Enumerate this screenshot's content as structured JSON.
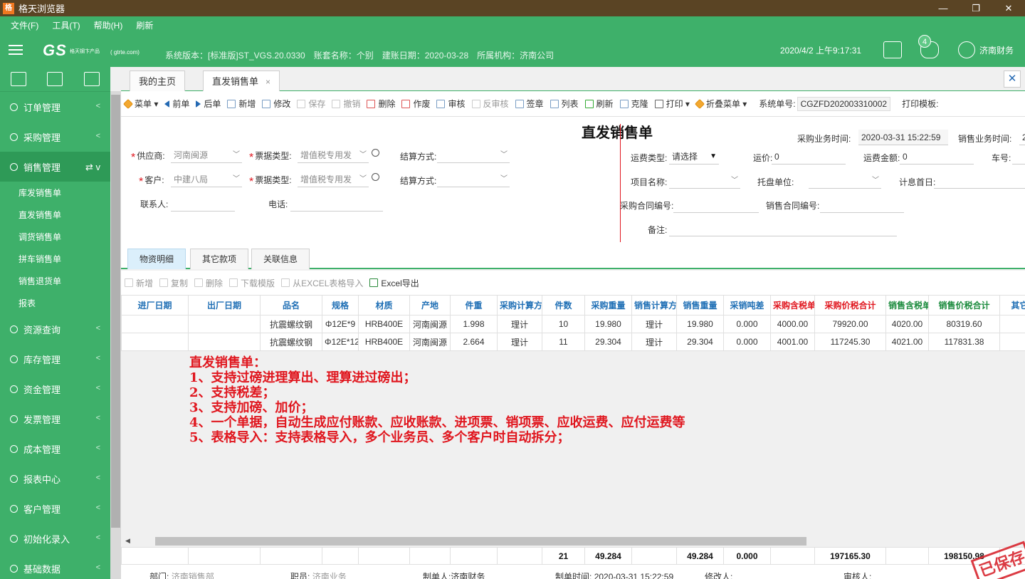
{
  "window": {
    "title": "格天浏览器",
    "min": "—",
    "max": "❐",
    "close": "✕"
  },
  "menu": [
    "文件(F)",
    "工具(T)",
    "帮助(H)",
    "刷新"
  ],
  "header": {
    "logo": "GS",
    "logo_sub": "格天钢卞产品",
    "logo_url": "( gtrte.com)",
    "sysinfo": "系统版本：[标准版]ST_VGS.20.0330　账套名称：个别　建账日期：2020-03-28　所属机构：济南公司",
    "datetime": "2020/4/2 上午9:17:31",
    "badge": "4",
    "user": "济南财务"
  },
  "sidebar": {
    "items": [
      {
        "label": "订单管理",
        "chev": "<"
      },
      {
        "label": "采购管理",
        "chev": "<"
      },
      {
        "label": "销售管理",
        "chev": "⇄ v"
      }
    ],
    "sub": [
      "库发销售单",
      "直发销售单",
      "调货销售单",
      "拼车销售单",
      "销售退货单",
      "报表"
    ],
    "items2": [
      {
        "label": "资源查询",
        "chev": "<"
      },
      {
        "label": "库存管理",
        "chev": "<"
      },
      {
        "label": "资金管理",
        "chev": "<"
      },
      {
        "label": "发票管理",
        "chev": "<"
      },
      {
        "label": "成本管理",
        "chev": "<"
      },
      {
        "label": "报表中心",
        "chev": "<"
      },
      {
        "label": "客户管理",
        "chev": "<"
      },
      {
        "label": "初始化录入",
        "chev": "<"
      },
      {
        "label": "基础数据",
        "chev": "<"
      }
    ]
  },
  "tabs": {
    "home": "我的主页",
    "current": "直发销售单",
    "x": "×",
    "close": "✕"
  },
  "toolbar": {
    "items": [
      "菜单 ▾",
      "前单",
      "后单",
      "新增",
      "修改",
      "保存",
      "撤销",
      "删除",
      "作废",
      "审核",
      "反审核",
      "签章",
      "列表",
      "刷新",
      "克隆",
      "打印 ▾",
      "折叠菜单 ▾"
    ],
    "sysno_label": "系统单号:",
    "sysno": "CGZFD202003310002",
    "print_tpl": "打印模板:"
  },
  "form": {
    "title": "直发销售单",
    "purchase_time_label": "采购业务时间:",
    "purchase_time": "2020-03-31 15:22:59",
    "sale_time_label": "销售业务时间:",
    "sale_time": "2",
    "supplier_label": "供应商:",
    "supplier": "河南闽源",
    "bill_type_label": "票据类型:",
    "bill_type": "增值税专用发",
    "settle_label": "结算方式:",
    "customer_label": "客户:",
    "customer": "中建八局",
    "contact_label": "联系人:",
    "phone_label": "电话:",
    "freight_type_label": "运费类型:",
    "freight_type": "请选择",
    "freight_price_label": "运价:",
    "freight_price": "0",
    "freight_amount_label": "运费金额:",
    "freight_amount": "0",
    "car_no_label": "车号:",
    "project_label": "项目名称:",
    "pallet_label": "托盘单位:",
    "interest_label": "计息首日:",
    "pcontract_label": "采购合同编号:",
    "scontract_label": "销售合同编号:",
    "remark_label": "备注:",
    "star": "*"
  },
  "subtabs": [
    "物资明细",
    "其它款项",
    "关联信息"
  ],
  "grid_toolbar": [
    "新增",
    "复制",
    "删除",
    "下载模版",
    "从EXCEL表格导入",
    "Excel导出"
  ],
  "grid": {
    "headers": [
      "进厂日期",
      "出厂日期",
      "品名",
      "规格",
      "材质",
      "产地",
      "件重",
      "采购计算方",
      "件数",
      "采购重量",
      "销售计算方",
      "销售重量",
      "采销吨差",
      "采购含税单",
      "采购价税合计",
      "销售含税单",
      "销售价税合计",
      "其它"
    ],
    "rows": [
      [
        "",
        "",
        "抗震螺纹钢",
        "Φ12E*9",
        "HRB400E",
        "河南闽源",
        "1.998",
        "理计",
        "10",
        "19.980",
        "理计",
        "19.980",
        "0.000",
        "4000.00",
        "79920.00",
        "4020.00",
        "80319.60",
        ""
      ],
      [
        "",
        "",
        "抗震螺纹钢",
        "Φ12E*12",
        "HRB400E",
        "河南闽源",
        "2.664",
        "理计",
        "11",
        "29.304",
        "理计",
        "29.304",
        "0.000",
        "4001.00",
        "117245.30",
        "4021.00",
        "117831.38",
        ""
      ]
    ],
    "totals": [
      "",
      "",
      "",
      "",
      "",
      "",
      "",
      "",
      "21",
      "49.284",
      "",
      "49.284",
      "0.000",
      "",
      "197165.30",
      "",
      "198150.98",
      ""
    ]
  },
  "note": [
    "直发销售单：",
    "1、支持过磅进理算出、理算进过磅出；",
    "2、支持税差；",
    "3、支持加磅、加价；",
    "4、一个单据，自动生成应付账款、应收账款、进项票、销项票、应收运费、应付运费等",
    "5、表格导入：支持表格导入，多个业务员、多个客户时自动拆分；"
  ],
  "footer": {
    "dept_label": "部门:",
    "dept": "济南销售部",
    "staff_label": "职员:",
    "staff": "济南业务",
    "maker_label": "制单人:",
    "maker": "济南财务",
    "make_time_label": "制单时间:",
    "make_time": "2020-03-31 15:22:59",
    "modifier_label": "修改人:",
    "auditor_label": "审核人:"
  },
  "stamp": "已保存"
}
